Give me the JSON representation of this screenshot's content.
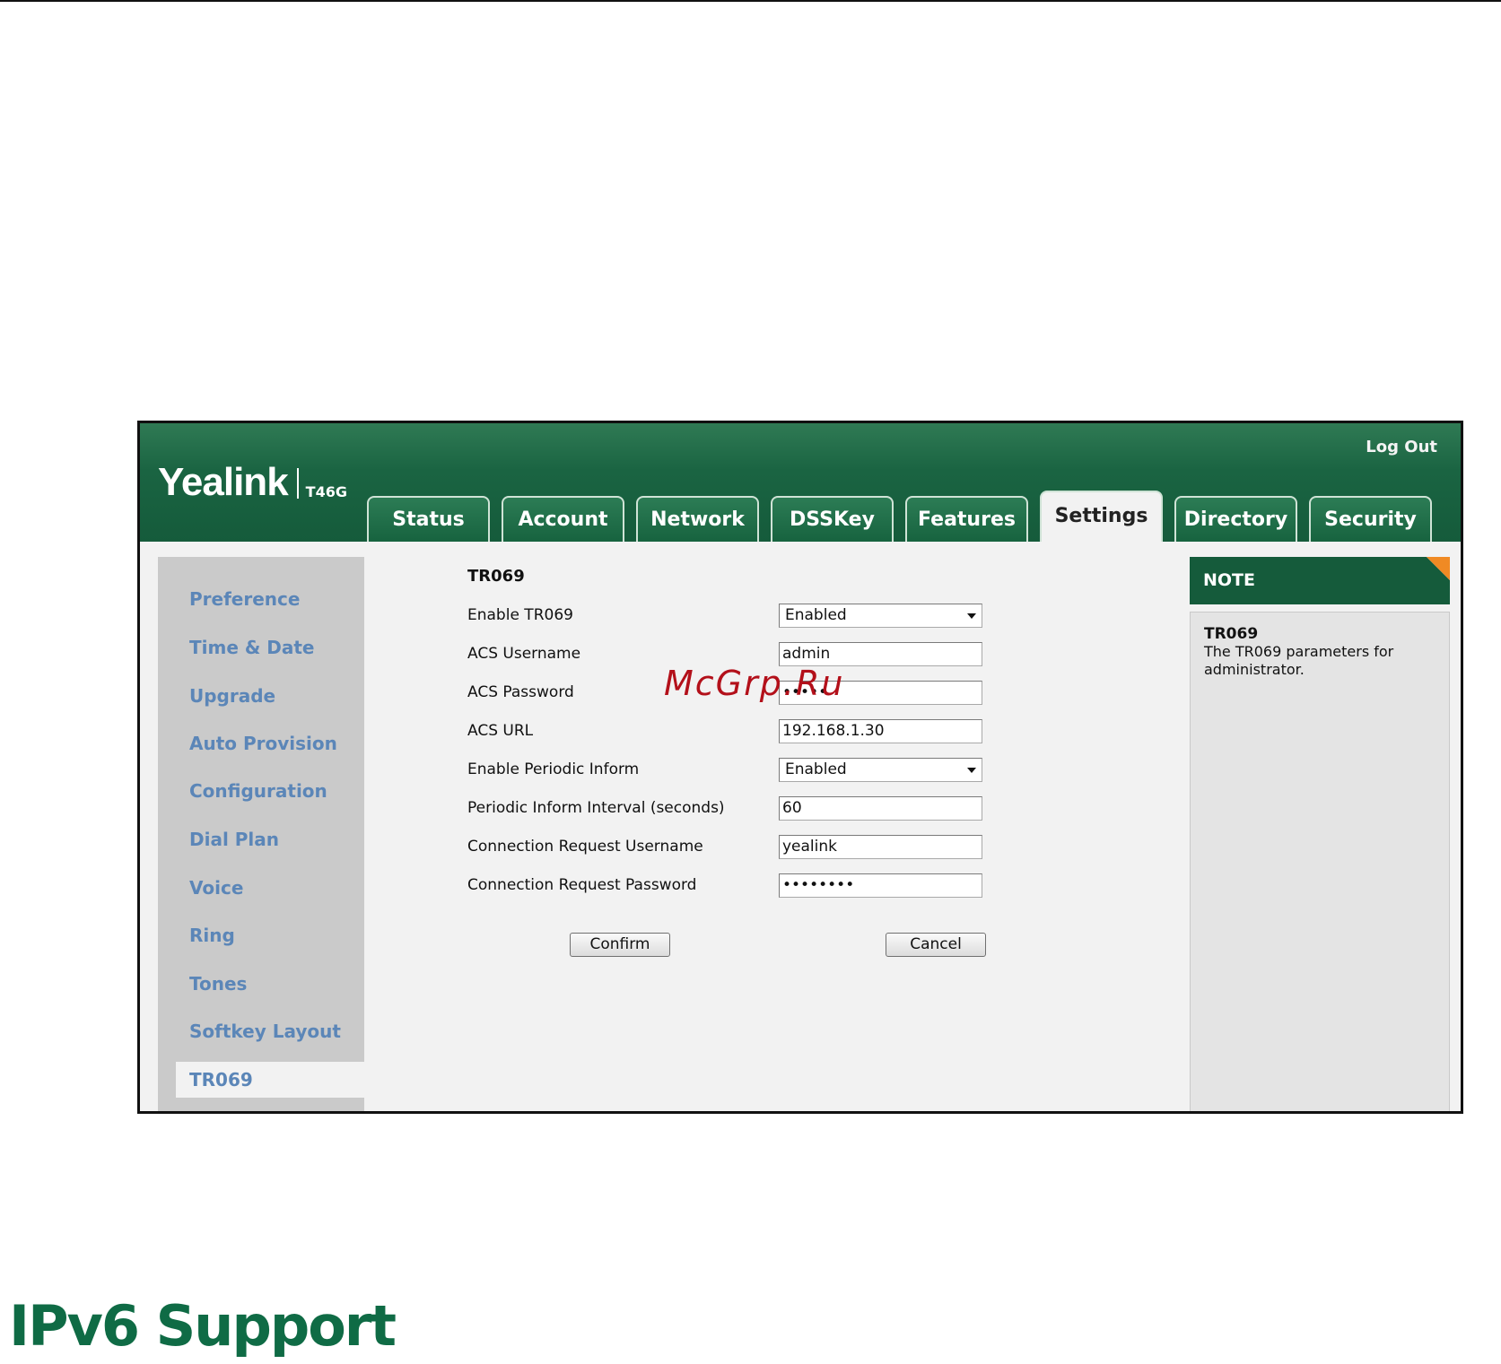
{
  "header": {
    "logout_label": "Log Out",
    "brand": "Yealink",
    "model": "T46G"
  },
  "tabs": [
    {
      "label": "Status",
      "active": false
    },
    {
      "label": "Account",
      "active": false
    },
    {
      "label": "Network",
      "active": false
    },
    {
      "label": "DSSKey",
      "active": false
    },
    {
      "label": "Features",
      "active": false
    },
    {
      "label": "Settings",
      "active": true
    },
    {
      "label": "Directory",
      "active": false
    },
    {
      "label": "Security",
      "active": false
    }
  ],
  "sidebar": {
    "items": [
      {
        "label": "Preference"
      },
      {
        "label": "Time & Date"
      },
      {
        "label": "Upgrade"
      },
      {
        "label": "Auto Provision"
      },
      {
        "label": "Configuration"
      },
      {
        "label": "Dial Plan"
      },
      {
        "label": "Voice"
      },
      {
        "label": "Ring"
      },
      {
        "label": "Tones"
      },
      {
        "label": "Softkey Layout"
      },
      {
        "label": "TR069"
      }
    ],
    "active": "TR069"
  },
  "form": {
    "section_title": "TR069",
    "rows": [
      {
        "label": "Enable TR069",
        "value": "Enabled",
        "type": "select"
      },
      {
        "label": "ACS Username",
        "value": "admin",
        "type": "text"
      },
      {
        "label": "ACS Password",
        "value": "•••••",
        "type": "password"
      },
      {
        "label": "ACS URL",
        "value": "192.168.1.30",
        "type": "text"
      },
      {
        "label": "Enable Periodic Inform",
        "value": "Enabled",
        "type": "select"
      },
      {
        "label": "Periodic Inform Interval (seconds)",
        "value": "60",
        "type": "text"
      },
      {
        "label": "Connection Request Username",
        "value": "yealink",
        "type": "text"
      },
      {
        "label": "Connection Request Password",
        "value": "••••••••",
        "type": "password"
      }
    ],
    "confirm_label": "Confirm",
    "cancel_label": "Cancel"
  },
  "note": {
    "heading": "NOTE",
    "title": "TR069",
    "text": "The TR069 parameters for administrator."
  },
  "watermark": "McGrp.Ru",
  "doc_heading": "IPv6 Support",
  "colors": {
    "header_green": "#155b3b",
    "sidebar_link": "#5b86b8",
    "note_corner": "#f08a24",
    "heading_green": "#0f6b45"
  }
}
